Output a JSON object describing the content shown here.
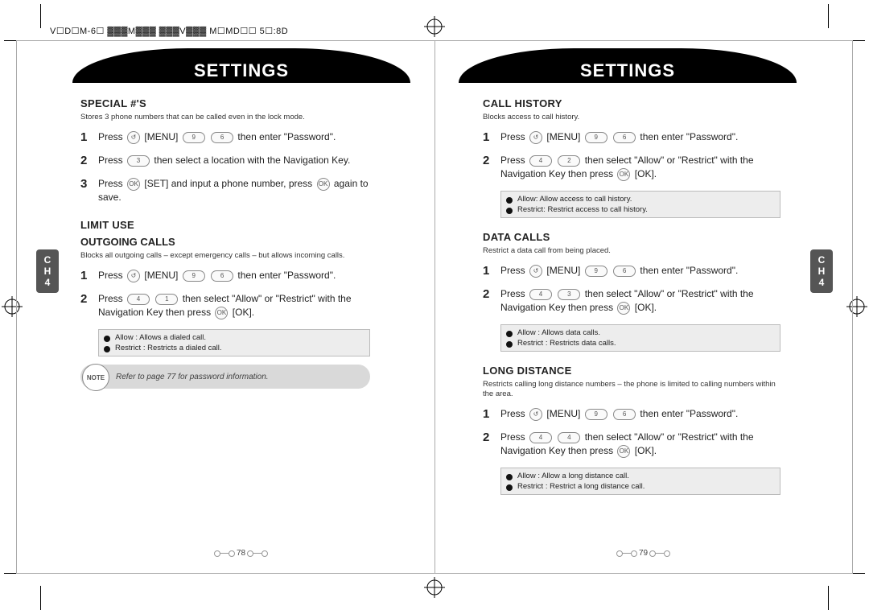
{
  "doc_header": "V☐D☐M-6☐ ▓▓▓M▓▓▓ ▓▓▓V▓▓▓ M☐MD☐☐ 5☐:8D",
  "left_page": {
    "banner": "SETTINGS",
    "tab": {
      "line1": "C",
      "line2": "H",
      "line3": "4"
    },
    "page_num": "78",
    "special": {
      "title": "SPECIAL #'S",
      "desc": "Stores 3 phone numbers that can be called even in the lock mode.",
      "steps": [
        {
          "n": "1",
          "pre": "Press",
          "k": [
            "↺",
            "9",
            "6"
          ],
          "post1": "[MENU]",
          "post2": "then enter \"Password\"."
        },
        {
          "n": "2",
          "pre": "Press",
          "k": [
            "3"
          ],
          "post": "then select a location with the Navigation Key."
        },
        {
          "n": "3",
          "pre": "Press",
          "k": [
            "OK"
          ],
          "post": "[SET] and input a phone number, press",
          "k2": [
            "OK"
          ],
          "post2": "again to save."
        }
      ]
    },
    "limit": {
      "title": "LIMIT USE",
      "sub": "OUTGOING CALLS",
      "desc": "Blocks all outgoing calls – except emergency calls – but allows incoming calls.",
      "steps": [
        {
          "n": "1",
          "pre": "Press",
          "k": [
            "↺",
            "9",
            "6"
          ],
          "post1": "[MENU]",
          "post2": "then enter \"Password\"."
        },
        {
          "n": "2",
          "pre": "Press",
          "k": [
            "4",
            "1"
          ],
          "mid": "then select \"Allow\" or \"Restrict\" with the Navigation Key then press",
          "k2": [
            "OK"
          ],
          "post2": "[OK]."
        }
      ],
      "info": {
        "a": "Allow : Allows a dialed call.",
        "b": "Restrict : Restricts a dialed call."
      },
      "note_badge": "NOTE",
      "note": "Refer to page 77 for password information."
    }
  },
  "right_page": {
    "banner": "SETTINGS",
    "tab": {
      "line1": "C",
      "line2": "H",
      "line3": "4"
    },
    "page_num": "79",
    "callhist": {
      "title": "CALL HISTORY",
      "desc": "Blocks access to call history.",
      "steps": [
        {
          "n": "1",
          "pre": "Press",
          "k": [
            "↺",
            "9",
            "6"
          ],
          "post1": "[MENU]",
          "post2": "then enter \"Password\"."
        },
        {
          "n": "2",
          "pre": "Press",
          "k": [
            "4",
            "2"
          ],
          "mid": "then select \"Allow\" or \"Restrict\" with the Navigation Key then press",
          "k2": [
            "OK"
          ],
          "post2": "[OK]."
        }
      ],
      "info": {
        "a": "Allow: Allow access to call history.",
        "b": "Restrict: Restrict access to call history."
      }
    },
    "datacalls": {
      "title": "DATA CALLS",
      "desc": "Restrict a data call from being placed.",
      "steps": [
        {
          "n": "1",
          "pre": "Press",
          "k": [
            "↺",
            "9",
            "6"
          ],
          "post1": "[MENU]",
          "post2": "then enter \"Password\"."
        },
        {
          "n": "2",
          "pre": "Press",
          "k": [
            "4",
            "3"
          ],
          "mid": "then select \"Allow\" or \"Restrict\" with the Navigation Key then press",
          "k2": [
            "OK"
          ],
          "post2": "[OK]."
        }
      ],
      "info": {
        "a": "Allow : Allows data calls.",
        "b": "Restrict : Restricts data calls."
      }
    },
    "longdist": {
      "title": "LONG DISTANCE",
      "desc": "Restricts calling long distance numbers – the phone is limited to calling numbers within the area.",
      "steps": [
        {
          "n": "1",
          "pre": "Press",
          "k": [
            "↺",
            "9",
            "6"
          ],
          "post1": "[MENU]",
          "post2": "then enter \"Password\"."
        },
        {
          "n": "2",
          "pre": "Press",
          "k": [
            "4",
            "4"
          ],
          "mid": "then select \"Allow\" or \"Restrict\" with the Navigation Key then press",
          "k2": [
            "OK"
          ],
          "post2": "[OK]."
        }
      ],
      "info": {
        "a": "Allow : Allow a long distance call.",
        "b": "Restrict : Restrict a long distance call."
      }
    }
  }
}
